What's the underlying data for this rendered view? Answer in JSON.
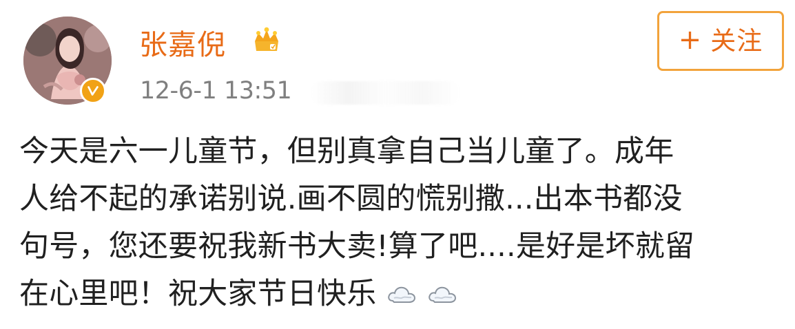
{
  "post": {
    "user": {
      "name": "张嘉倪",
      "avatar_icon": "user-avatar",
      "verified_icon": "verified-v-badge",
      "vip_icon": "crown-icon"
    },
    "timestamp": "12-6-1 13:51",
    "follow_button": {
      "plus": "+",
      "label": "关注"
    },
    "content_lines": [
      "今天是六一儿童节，但别真拿自己当儿童了。成年",
      "人给不起的承诺别说.画不圆的慌别撒...出本书都没",
      "句号，您还要祝我新书大卖!算了吧....是好是坏就留",
      "在心里吧！祝大家节日快乐"
    ],
    "emojis": [
      "cloud-icon",
      "cloud-icon"
    ],
    "colors": {
      "username": "#e86b17",
      "follow_border": "#f2a33b",
      "timestamp": "#7f7f7f",
      "content": "#202020",
      "verified_badge": "#f1a216"
    }
  }
}
